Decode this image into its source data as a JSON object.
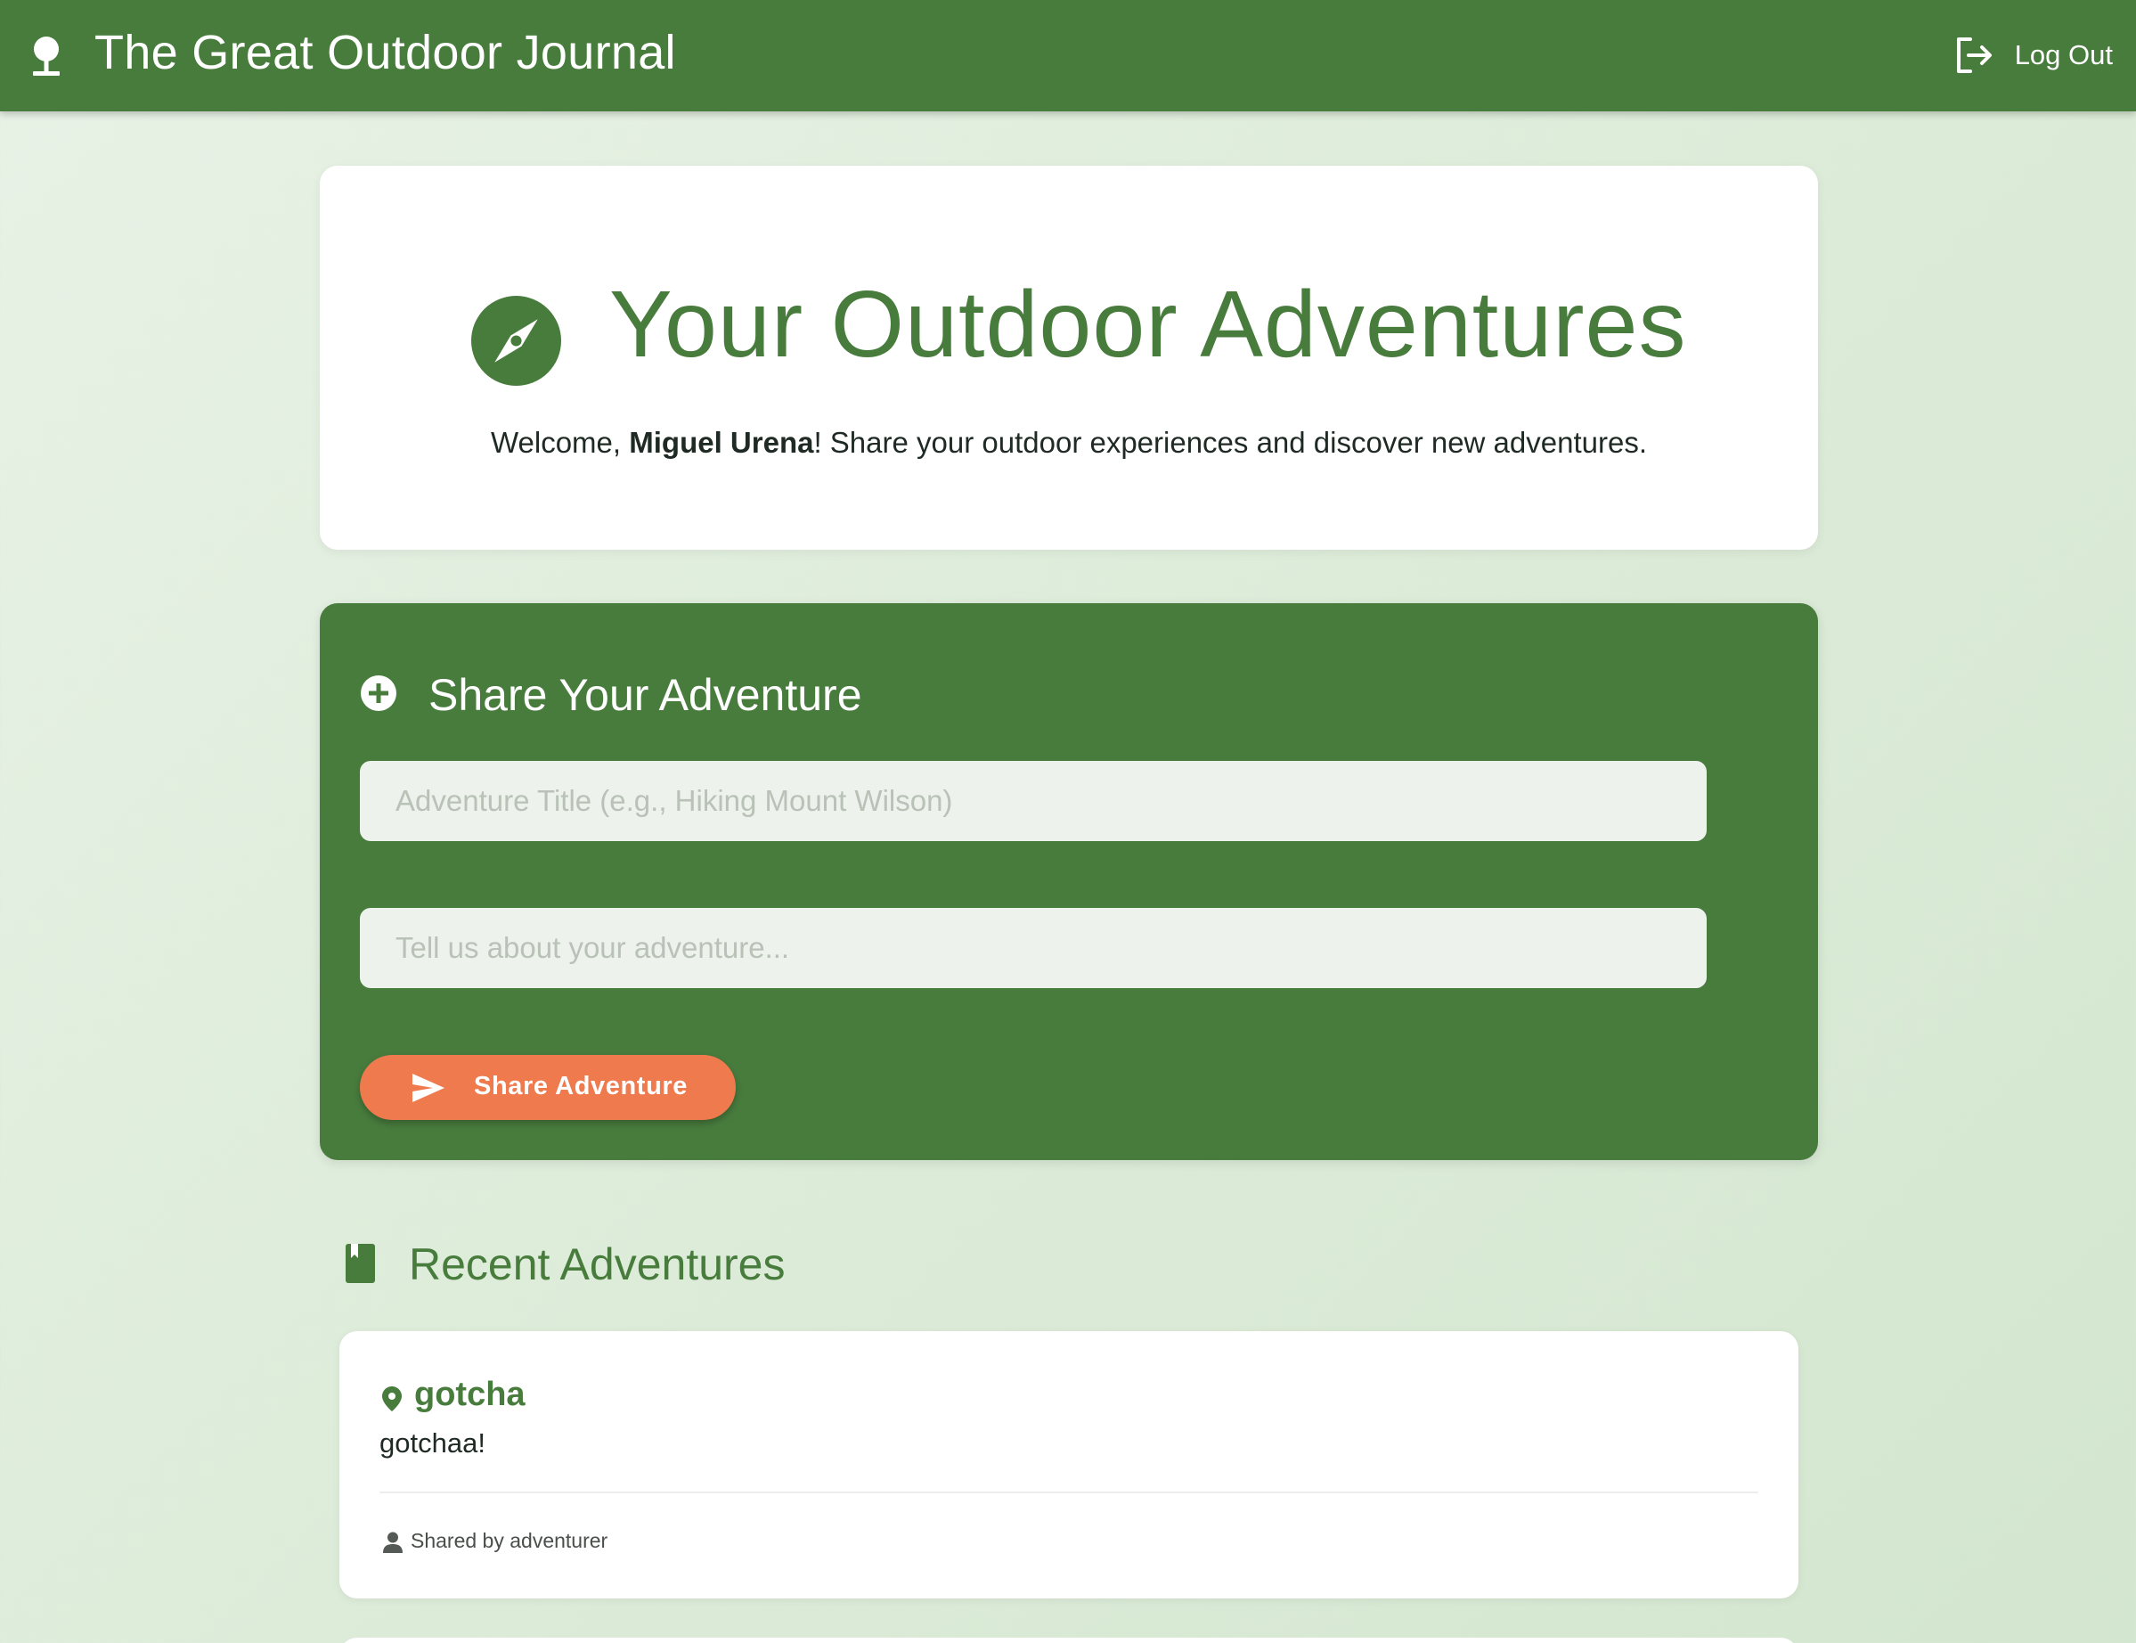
{
  "header": {
    "brand_icon": "tree-icon",
    "title": "The Great Outdoor Journal",
    "logout_icon": "logout-icon",
    "logout_label": "Log Out"
  },
  "hero": {
    "icon": "compass-icon",
    "title": "Your Outdoor Adventures",
    "welcome_prefix": "Welcome, ",
    "user_name": "Miguel Urena",
    "welcome_suffix": "! Share your outdoor experiences and discover new adventures."
  },
  "share_form": {
    "icon": "add-circle-icon",
    "heading": "Share Your Adventure",
    "title_field": {
      "value": "",
      "placeholder": "Adventure Title (e.g., Hiking Mount Wilson)"
    },
    "story_field": {
      "value": "",
      "placeholder": "Tell us about your adventure..."
    },
    "submit_icon": "send-icon",
    "submit_label": "Share Adventure"
  },
  "recent": {
    "icon": "book-icon",
    "heading": "Recent Adventures",
    "posts": [
      {
        "icon": "location-pin-icon",
        "title": "gotcha",
        "body": "gotchaa!",
        "author_icon": "person-icon",
        "meta": "Shared by adventurer"
      }
    ]
  },
  "colors": {
    "primary_green": "#487c3d",
    "accent_orange": "#ee7a4e",
    "background_light": "#e3efe0",
    "card_white": "#ffffff"
  }
}
